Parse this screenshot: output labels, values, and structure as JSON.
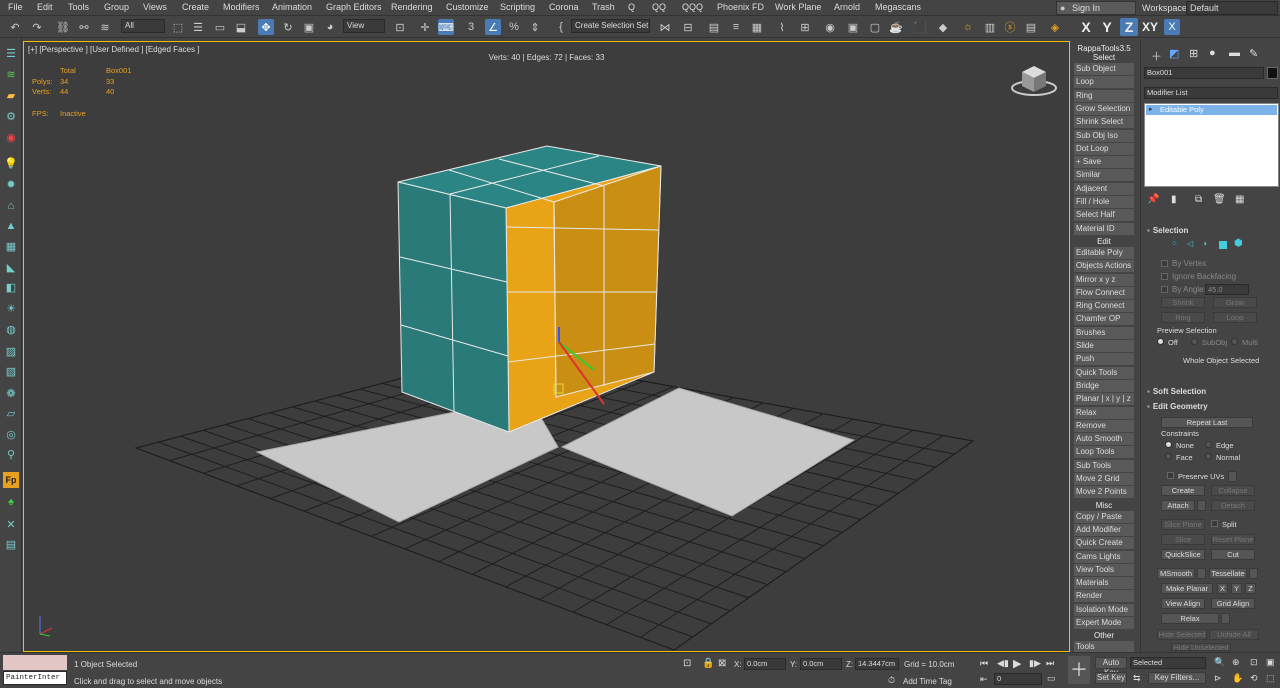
{
  "menubar": {
    "items": [
      "File",
      "Edit",
      "Tools",
      "Group",
      "Views",
      "Create",
      "Modifiers",
      "Animation",
      "Graph Editors",
      "Rendering",
      "Customize",
      "Scripting",
      "Corona",
      "Trash",
      "Q",
      "QQ",
      "QQQ",
      "Phoenix FD",
      "Work Plane",
      "Arnold",
      "Megascans"
    ],
    "sign_in": "Sign In",
    "workspaces_label": "Workspaces:",
    "workspace_value": "Default"
  },
  "toolbar": {
    "filter_value": "All",
    "ref_coord_value": "View",
    "selection_set_placeholder": "Create Selection Set",
    "axis_labels": [
      "X",
      "Y",
      "Z",
      "XY"
    ],
    "move_active": true,
    "z_active": true
  },
  "viewport": {
    "label": "[+] [Perspective ] [User Defined ] [Edged Faces ]",
    "subobj_stats": "Verts: 40 | Edges: 72 | Faces: 33",
    "stats": {
      "total_label": "Total",
      "object_label": "Box001",
      "polys_label": "Polys:",
      "polys_total": "34",
      "polys_obj": "33",
      "verts_label": "Verts:",
      "verts_total": "44",
      "verts_obj": "40",
      "fps_label": "FPS:",
      "fps_value": "Inactive"
    },
    "colors": {
      "border": "#f0c000",
      "teal": "#2b7a7a",
      "gold": "#e8a317",
      "plane": "#c8c8c8"
    }
  },
  "rappa": {
    "title": "RappaTools3.5",
    "sections": [
      {
        "header": "Select",
        "items": [
          "Sub Object",
          "Loop",
          "Ring",
          "Grow Selection",
          "Shrink Select",
          "Sub Obj Iso",
          "Dot Loop",
          "+ Save",
          "Similar",
          "Adjacent",
          "Fill / Hole",
          "Select Half",
          "Material ID"
        ]
      },
      {
        "header": "Edit",
        "items": [
          "Editable Poly",
          "Objects Actions",
          "Mirror   x  y  z",
          "Flow Connect",
          "Ring Connect",
          "Chamfer OP",
          "Brushes",
          "Slide",
          "Push",
          "Quick Tools",
          "Bridge",
          "Planar | x | y | z",
          "Relax",
          "Remove",
          "Auto Smooth",
          "Loop Tools",
          "Sub Tools",
          "Move 2 Grid",
          "Move 2 Points"
        ]
      },
      {
        "header": "Misc",
        "items": [
          "Copy / Paste",
          "Add Modifier",
          "Quick Create",
          "Cams Lights",
          "View Tools",
          "Materials",
          "Render",
          "Isolation Mode",
          "Expert Mode"
        ]
      },
      {
        "header": "Other",
        "items": [
          "Tools"
        ]
      }
    ]
  },
  "command_panel": {
    "object_name": "Box001",
    "modifier_list": "Modifier List",
    "stack_item": "Editable Poly",
    "selection": {
      "title": "Selection",
      "by_vertex": "By Vertex",
      "ignore_backfacing": "Ignore Backfacing",
      "by_angle": "By Angle:",
      "angle_value": "45.0",
      "shrink": "Shrink",
      "grow": "Grow",
      "ring": "Ring",
      "loop": "Loop",
      "preview_title": "Preview Selection",
      "preview_off": "Off",
      "preview_subobj": "SubObj",
      "preview_multi": "Multi",
      "status": "Whole Object Selected"
    },
    "soft_selection_title": "Soft Selection",
    "edit_geometry": {
      "title": "Edit Geometry",
      "repeat_last": "Repeat Last",
      "constraints": "Constraints",
      "c_none": "None",
      "c_edge": "Edge",
      "c_face": "Face",
      "c_normal": "Normal",
      "preserve_uvs": "Preserve UVs",
      "create": "Create",
      "collapse": "Collapse",
      "attach": "Attach",
      "detach": "Detach",
      "slice_plane": "Slice Plane",
      "split": "Split",
      "slice": "Slice",
      "reset_plane": "Reset Plane",
      "quickslice": "QuickSlice",
      "cut": "Cut",
      "msmooth": "MSmooth",
      "tessellate": "Tessellate",
      "make_planar": "Make Planar",
      "x": "X",
      "y": "Y",
      "z": "Z",
      "view_align": "View Align",
      "grid_align": "Grid Align",
      "relax": "Relax",
      "hide_selected": "Hide Selected",
      "unhide_all": "Unhide All",
      "hide_unselected": "Hide Unselected"
    }
  },
  "statusbar": {
    "script_field": "PainterInter",
    "selected_text": "1 Object Selected",
    "prompt": "Click and drag to select and move objects",
    "x_label": "X:",
    "x_value": "0.0cm",
    "y_label": "Y:",
    "y_value": "0.0cm",
    "z_label": "Z:",
    "z_value": "14.3447cm",
    "grid": "Grid = 10.0cm",
    "add_time_tag": "Add Time Tag",
    "frame": "0",
    "auto_key": "Auto Key",
    "set_key": "Set Key",
    "selected_dd": "Selected",
    "key_filters": "Key Filters..."
  }
}
